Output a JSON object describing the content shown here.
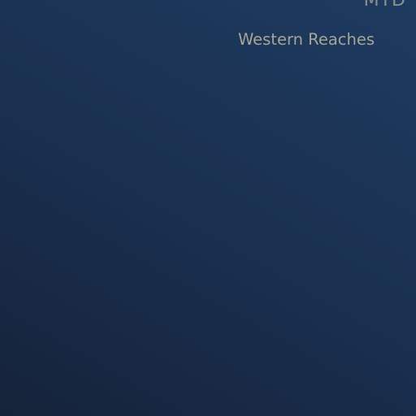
{
  "panel": {
    "corner_label": "MTD",
    "region_label": "Western Reaches"
  },
  "colors": {
    "background_dark": "#15233a",
    "background_light": "#1e3b60",
    "label_text": "#a6a595"
  }
}
